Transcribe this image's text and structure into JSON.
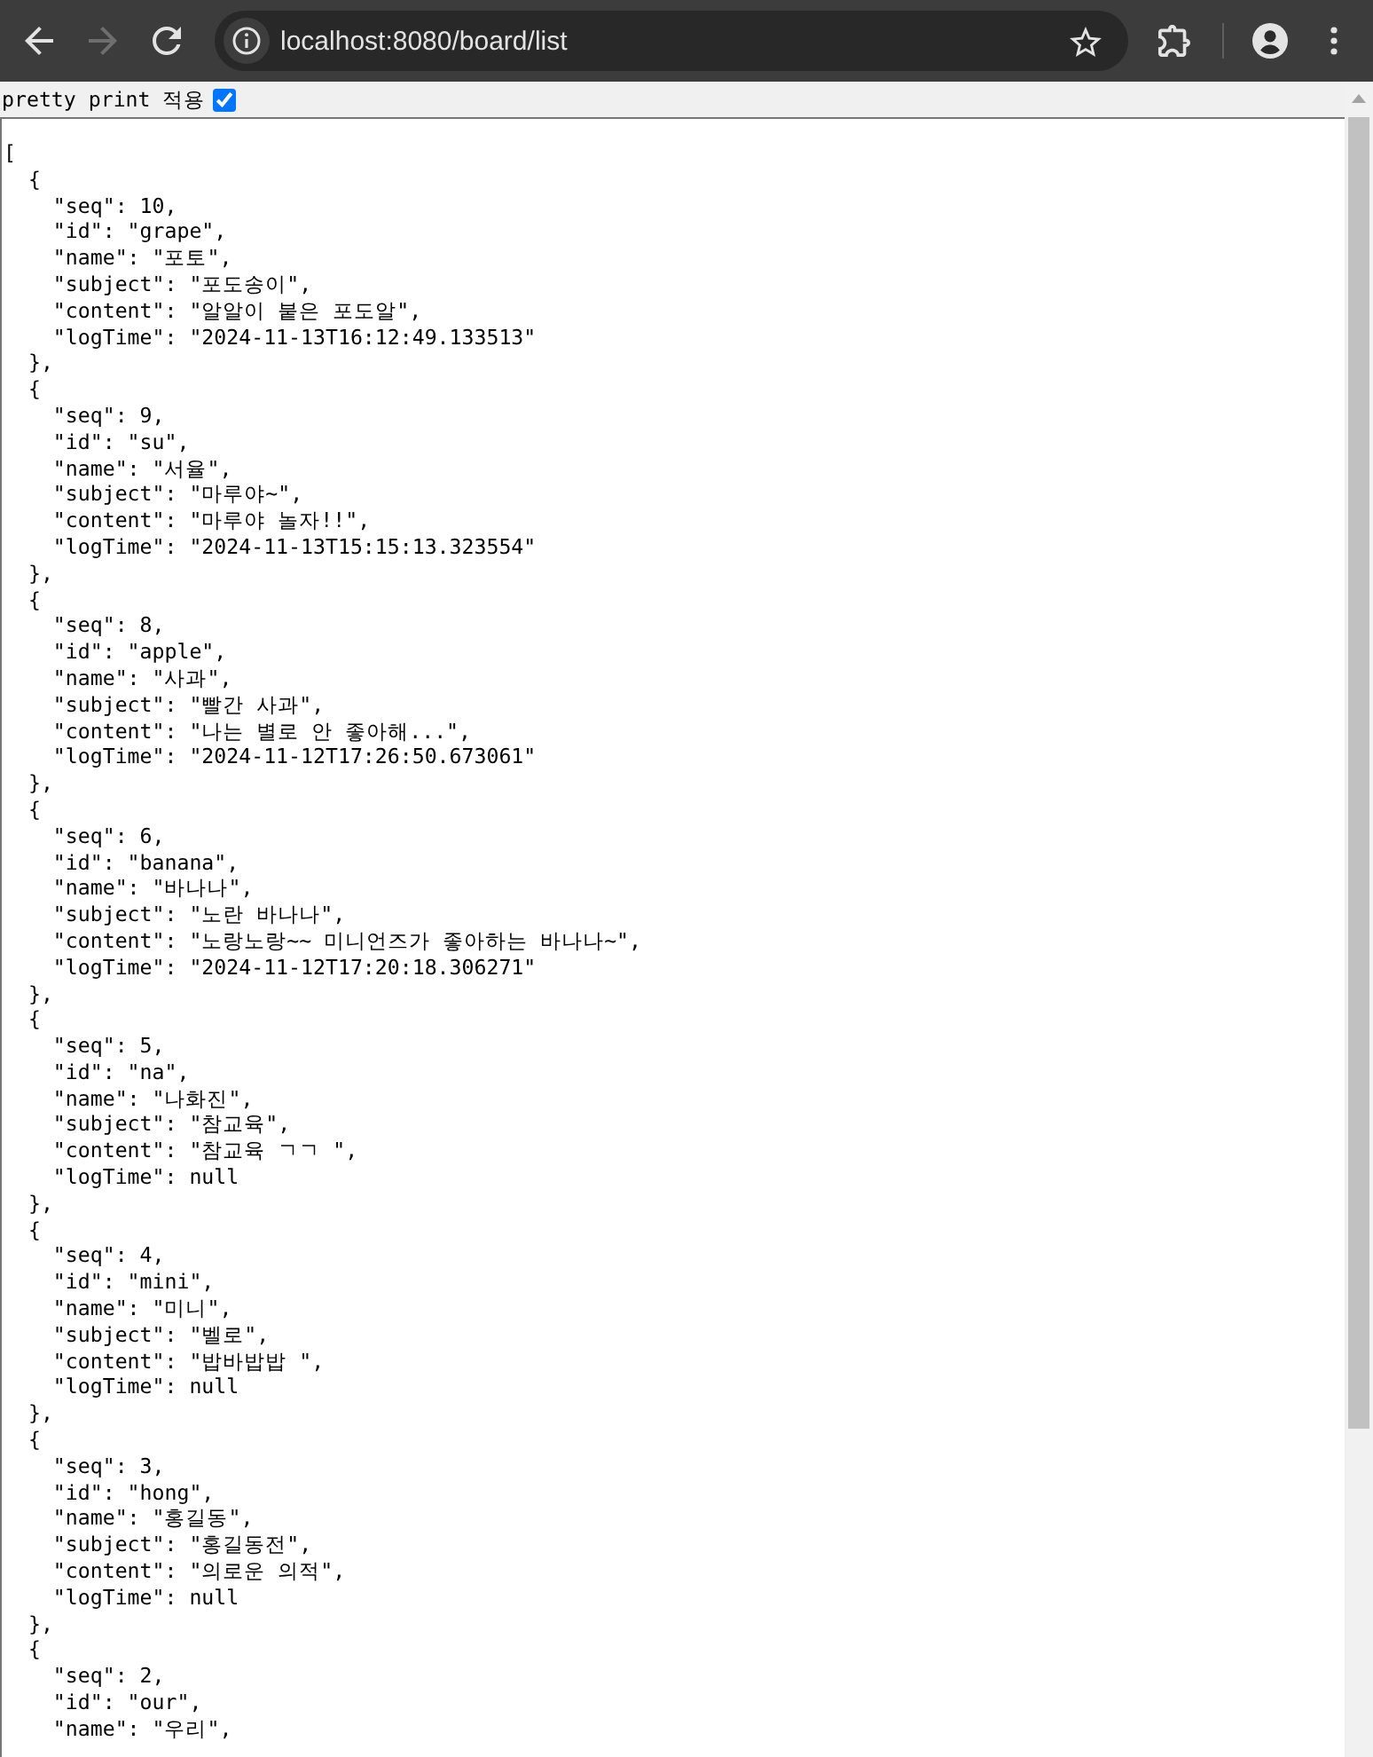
{
  "browser": {
    "nav_buttons": [
      {
        "kind": "back",
        "disabled": false
      },
      {
        "kind": "forward",
        "disabled": true
      },
      {
        "kind": "reload",
        "disabled": false
      }
    ],
    "url": "localhost:8080/board/list"
  },
  "pretty_print": {
    "label": "pretty print 적용",
    "checked": true
  },
  "output": {
    "lines": [
      "[",
      "  {",
      "    \"seq\": 10,",
      "    \"id\": \"grape\",",
      "    \"name\": \"포토\",",
      "    \"subject\": \"포도송이\",",
      "    \"content\": \"알알이 붙은 포도알\",",
      "    \"logTime\": \"2024-11-13T16:12:49.133513\"",
      "  },",
      "  {",
      "    \"seq\": 9,",
      "    \"id\": \"su\",",
      "    \"name\": \"서율\",",
      "    \"subject\": \"마루야~\",",
      "    \"content\": \"마루야 놀자!!\",",
      "    \"logTime\": \"2024-11-13T15:15:13.323554\"",
      "  },",
      "  {",
      "    \"seq\": 8,",
      "    \"id\": \"apple\",",
      "    \"name\": \"사과\",",
      "    \"subject\": \"빨간 사과\",",
      "    \"content\": \"나는 별로 안 좋아해...\",",
      "    \"logTime\": \"2024-11-12T17:26:50.673061\"",
      "  },",
      "  {",
      "    \"seq\": 6,",
      "    \"id\": \"banana\",",
      "    \"name\": \"바나나\",",
      "    \"subject\": \"노란 바나나\",",
      "    \"content\": \"노랑노랑~~ 미니언즈가 좋아하는 바나나~\",",
      "    \"logTime\": \"2024-11-12T17:20:18.306271\"",
      "  },",
      "  {",
      "    \"seq\": 5,",
      "    \"id\": \"na\",",
      "    \"name\": \"나화진\",",
      "    \"subject\": \"참교육\",",
      "    \"content\": \"참교육 ㄱㄱ \",",
      "    \"logTime\": null",
      "  },",
      "  {",
      "    \"seq\": 4,",
      "    \"id\": \"mini\",",
      "    \"name\": \"미니\",",
      "    \"subject\": \"벨로\",",
      "    \"content\": \"밥바밥밥 \",",
      "    \"logTime\": null",
      "  },",
      "  {",
      "    \"seq\": 3,",
      "    \"id\": \"hong\",",
      "    \"name\": \"홍길동\",",
      "    \"subject\": \"홍길동전\",",
      "    \"content\": \"의로운 의적\",",
      "    \"logTime\": null",
      "  },",
      "  {",
      "    \"seq\": 2,",
      "    \"id\": \"our\",",
      "    \"name\": \"우리\","
    ]
  }
}
